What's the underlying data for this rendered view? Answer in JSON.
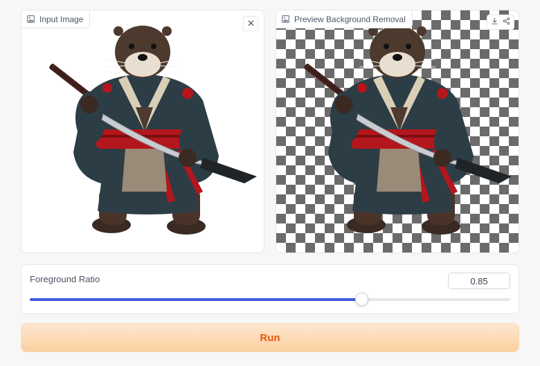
{
  "input_panel": {
    "label": "Input Image",
    "label_icon": "image-icon",
    "close_icon": "close-icon"
  },
  "preview_panel": {
    "label": "Preview Background Removal",
    "label_icon": "image-icon",
    "download_icon": "download-icon",
    "share_icon": "share-icon"
  },
  "slider": {
    "label": "Foreground Ratio",
    "value": "0.85",
    "fraction": 0.69
  },
  "run_button": {
    "label": "Run"
  },
  "colors": {
    "accent": "#3b5bdb",
    "run_text": "#ea580c",
    "run_bg": "#fbcf9f"
  }
}
